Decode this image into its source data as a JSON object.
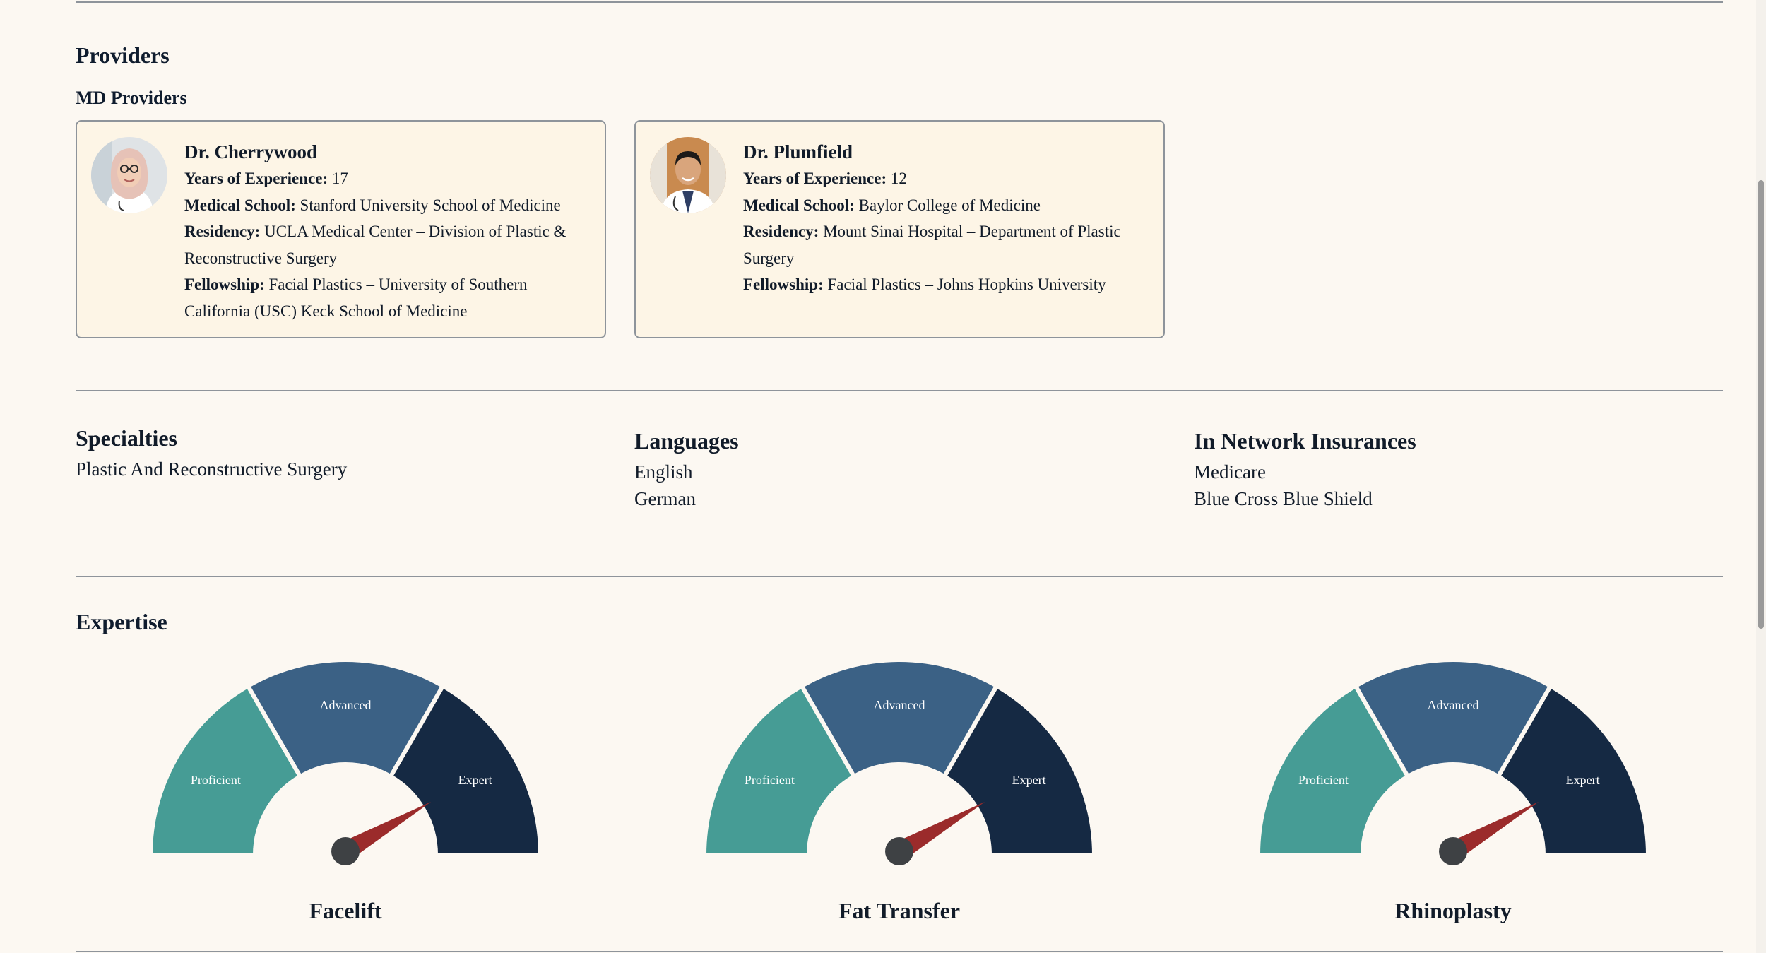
{
  "providers": {
    "title": "Providers",
    "subtitle": "MD Providers",
    "cards": [
      {
        "name": "Dr. Cherrywood",
        "experience_label": "Years of Experience:",
        "experience_value": "17",
        "school_label": "Medical School:",
        "school_value": "Stanford University School of Medicine",
        "residency_label": "Residency:",
        "residency_value": "UCLA Medical Center – Division of Plastic & Reconstructive Surgery",
        "fellowship_label": "Fellowship:",
        "fellowship_value": "Facial Plastics – University of Southern California (USC) Keck School of Medicine",
        "avatar_icon": "female-doctor-avatar"
      },
      {
        "name": "Dr. Plumfield",
        "experience_label": "Years of Experience:",
        "experience_value": "12",
        "school_label": "Medical School:",
        "school_value": "Baylor College of Medicine",
        "residency_label": "Residency:",
        "residency_value": "Mount Sinai Hospital – Department of Plastic Surgery",
        "fellowship_label": "Fellowship:",
        "fellowship_value": "Facial Plastics – Johns Hopkins University",
        "avatar_icon": "male-doctor-avatar"
      }
    ]
  },
  "specialties": {
    "title": "Specialties",
    "items": [
      "Plastic And Reconstructive Surgery"
    ]
  },
  "languages": {
    "title": "Languages",
    "items": [
      "English",
      "German"
    ]
  },
  "insurances": {
    "title": "In Network Insurances",
    "items": [
      "Medicare",
      "Blue Cross Blue Shield"
    ]
  },
  "expertise": {
    "title": "Expertise",
    "levels": [
      "Proficient",
      "Advanced",
      "Expert"
    ],
    "colors": {
      "proficient": "#469c95",
      "advanced": "#3b6185",
      "expert": "#152943",
      "needle": "#9b2b2b",
      "hub": "#3e4144"
    },
    "gauges": [
      {
        "procedure": "Facelift",
        "level": "Expert"
      },
      {
        "procedure": "Fat Transfer",
        "level": "Expert"
      },
      {
        "procedure": "Rhinoplasty",
        "level": "Expert"
      }
    ]
  }
}
